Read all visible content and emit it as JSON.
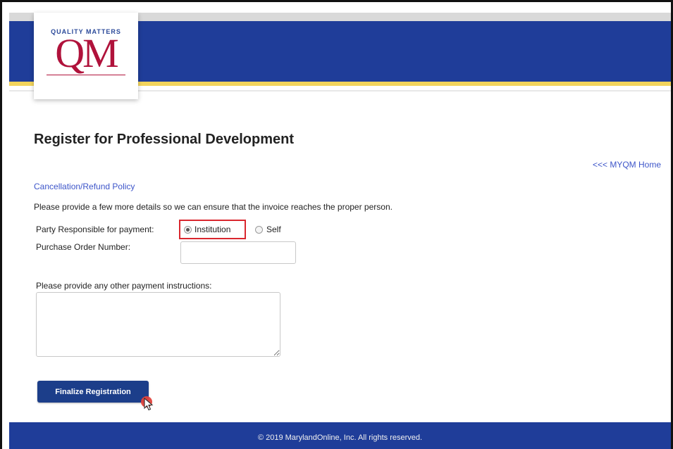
{
  "logo": {
    "small_text": "QUALITY MATTERS",
    "big_text": "QM"
  },
  "page": {
    "title": "Register for Professional Development",
    "home_link": "<<< MYQM Home",
    "policy_link": "Cancellation/Refund Policy",
    "intro": "Please provide a few more details so we can ensure that the invoice reaches the proper person."
  },
  "form": {
    "party_label": "Party Responsible for payment:",
    "party_options": [
      "Institution",
      "Self"
    ],
    "party_selected": "Institution",
    "po_label": "Purchase Order Number:",
    "po_value": "",
    "instructions_label": "Please provide any other payment instructions:",
    "instructions_value": "",
    "finalize_label": "Finalize Registration"
  },
  "footer": {
    "text": "© 2019 MarylandOnline, Inc. All rights reserved."
  },
  "colors": {
    "banner_blue": "#1f3d99",
    "banner_gold": "#f2d45c",
    "logo_red": "#b0123b",
    "link_blue": "#3d55c9",
    "highlight_red": "#d9272e",
    "button_blue": "#1c3e8a"
  }
}
